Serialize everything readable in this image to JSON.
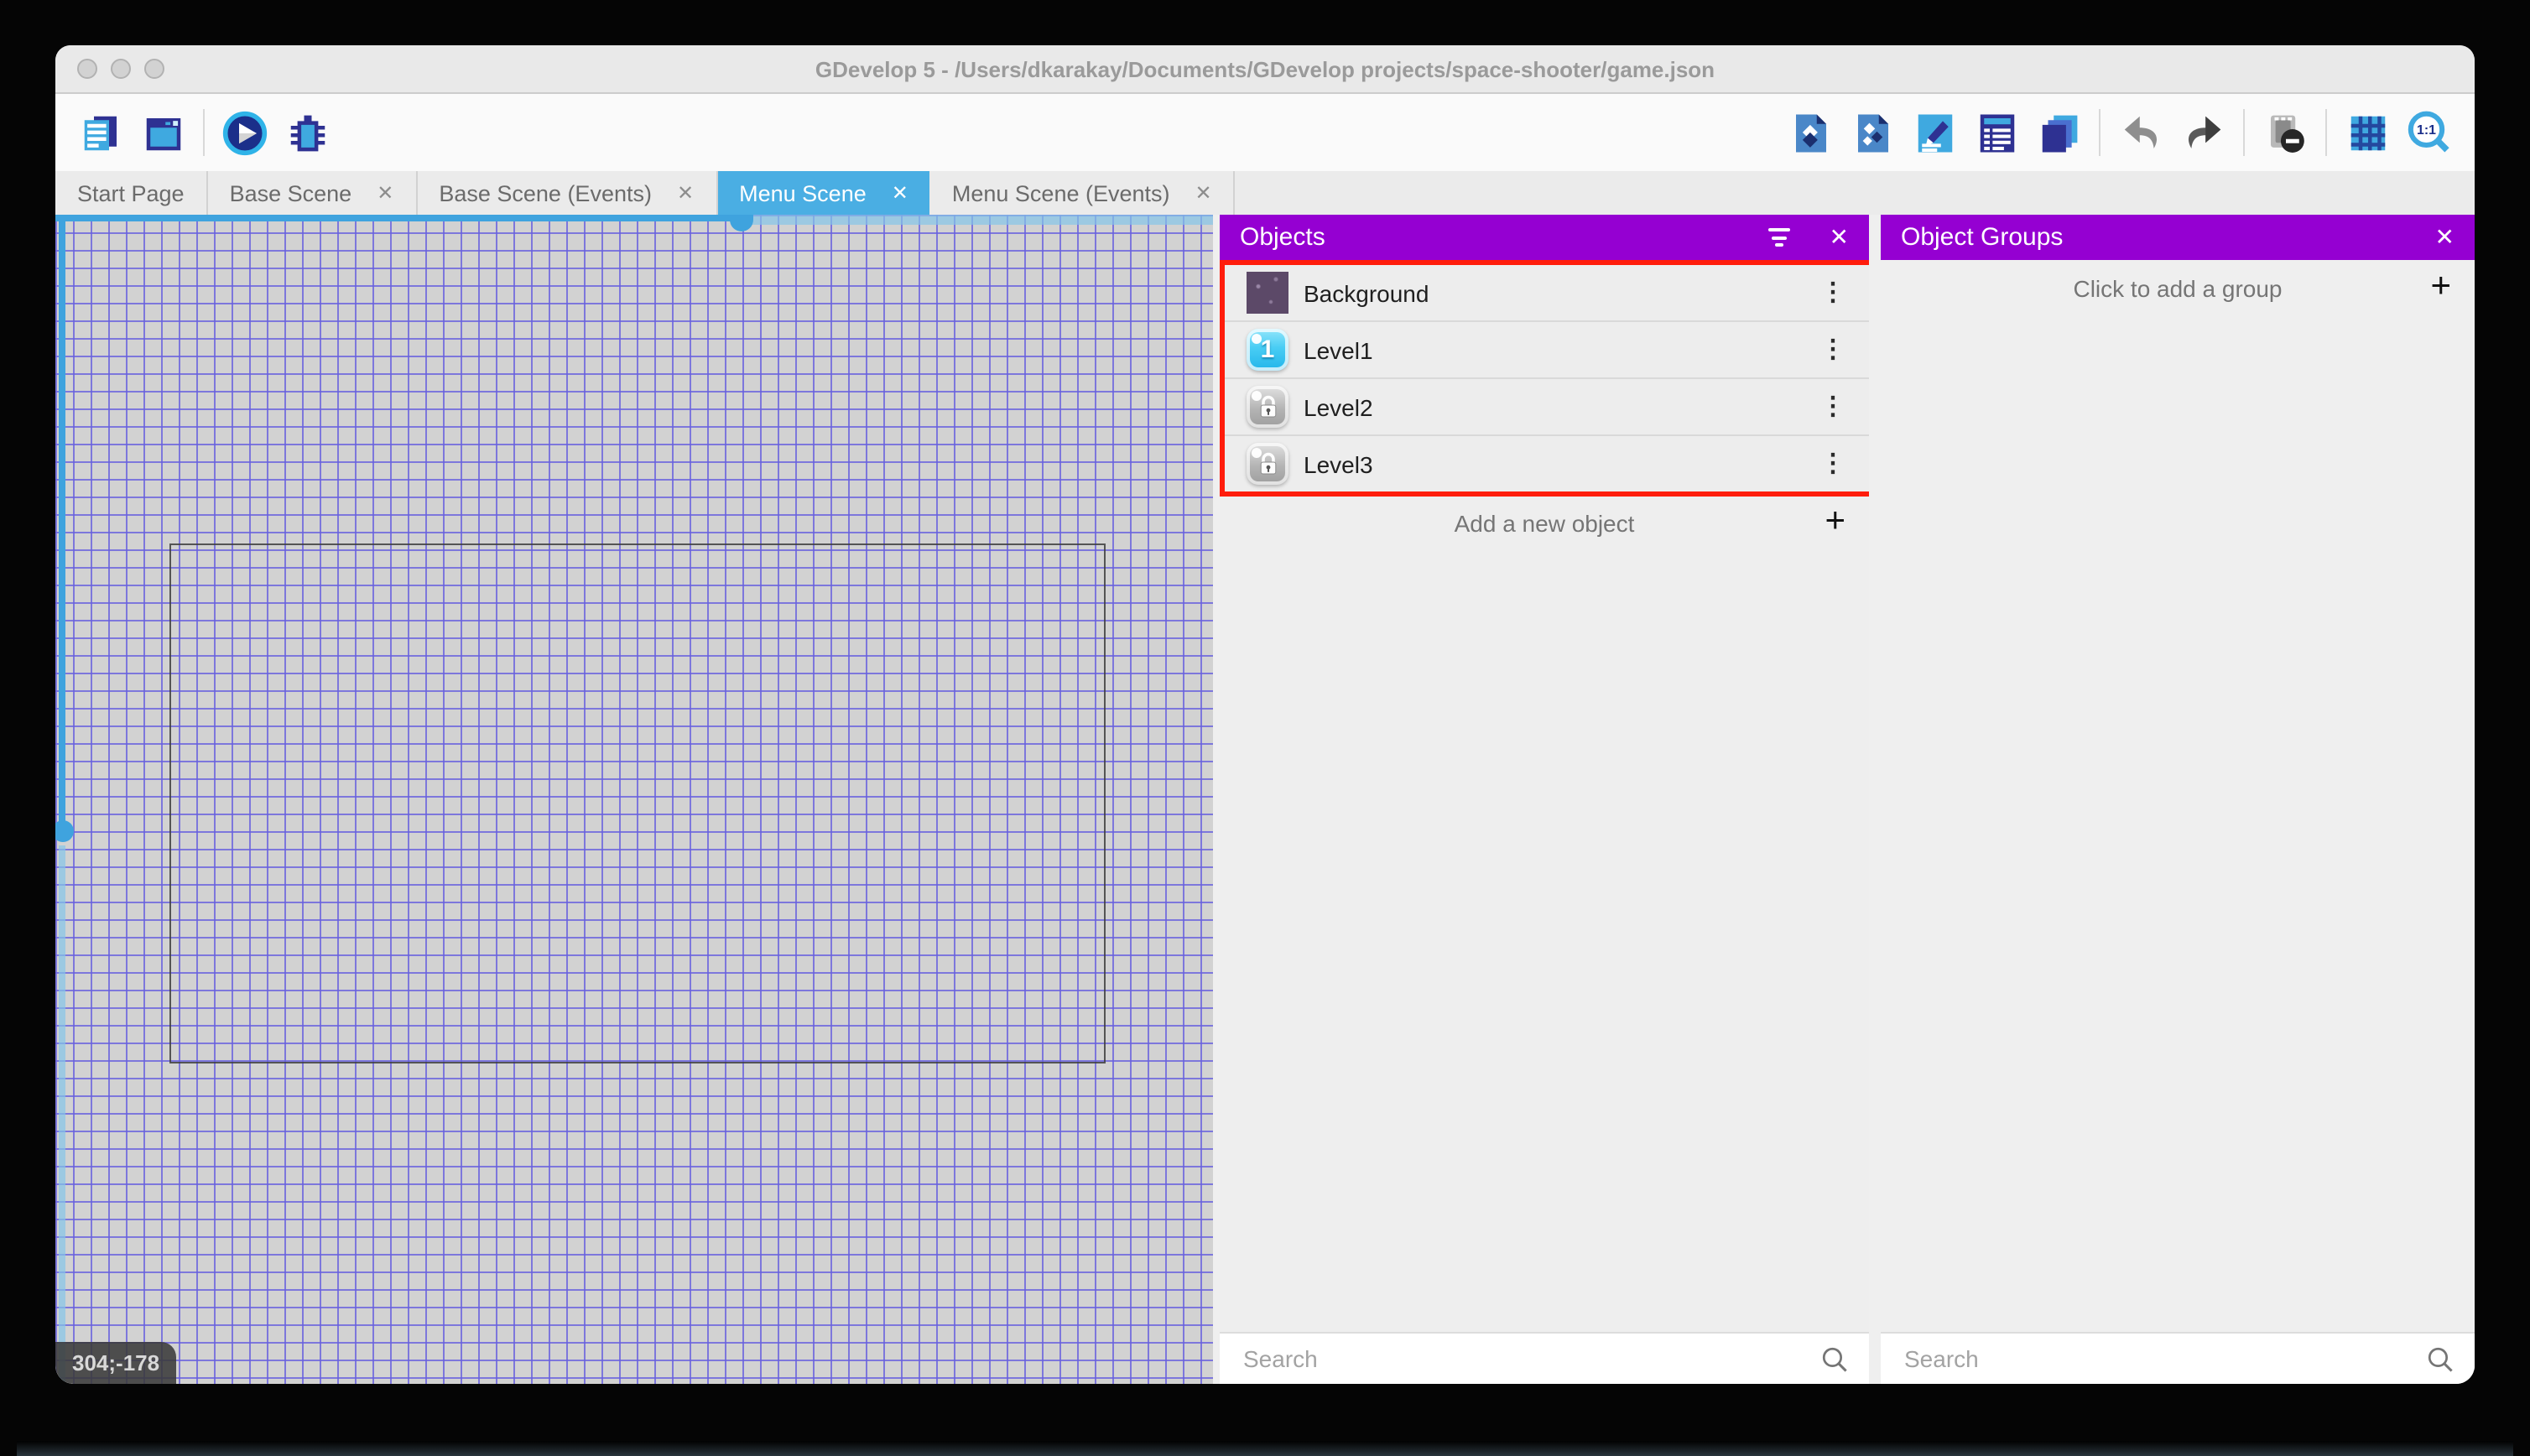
{
  "window": {
    "title": "GDevelop 5 - /Users/dkarakay/Documents/GDevelop projects/space-shooter/game.json"
  },
  "toolbar": {
    "zoom_ratio": "1:1",
    "left_icons": [
      "project-manager-icon",
      "start-page-icon",
      "play-icon",
      "debug-icon"
    ],
    "right_icons": [
      "objects-editor-icon",
      "instances-editor-icon",
      "properties-icon",
      "instances-list-icon",
      "layers-icon",
      "undo-icon",
      "redo-icon",
      "window-mask-icon",
      "grid-icon",
      "zoom-ratio-icon"
    ]
  },
  "tabs": [
    {
      "label": "Start Page",
      "active": false,
      "closable": false
    },
    {
      "label": "Base Scene",
      "active": false,
      "closable": true
    },
    {
      "label": "Base Scene (Events)",
      "active": false,
      "closable": true
    },
    {
      "label": "Menu Scene",
      "active": true,
      "closable": true
    },
    {
      "label": "Menu Scene (Events)",
      "active": false,
      "closable": true
    }
  ],
  "glyphs": {
    "close": "✕",
    "kebab": "⋮",
    "plus": "+"
  },
  "canvas": {
    "coordinates": "304;-178"
  },
  "objects_panel": {
    "title": "Objects",
    "items": [
      {
        "name": "Background",
        "icon": "space-background-thumbnail"
      },
      {
        "name": "Level1",
        "icon": "level1-button-thumbnail"
      },
      {
        "name": "Level2",
        "icon": "locked-button-thumbnail"
      },
      {
        "name": "Level3",
        "icon": "locked-button-thumbnail"
      }
    ],
    "add_label": "Add a new object",
    "search_placeholder": "Search"
  },
  "groups_panel": {
    "title": "Object Groups",
    "add_label": "Click to add a group",
    "search_placeholder": "Search"
  },
  "colors": {
    "panel_header_purple": "#9500d2",
    "highlight_red": "#ff1d0c",
    "active_tab_blue": "#4aaee3",
    "grid_line_blue": "#6860de",
    "scrollbar_blue": "#3fa3de",
    "canvas_gray": "#d2d2d2"
  }
}
